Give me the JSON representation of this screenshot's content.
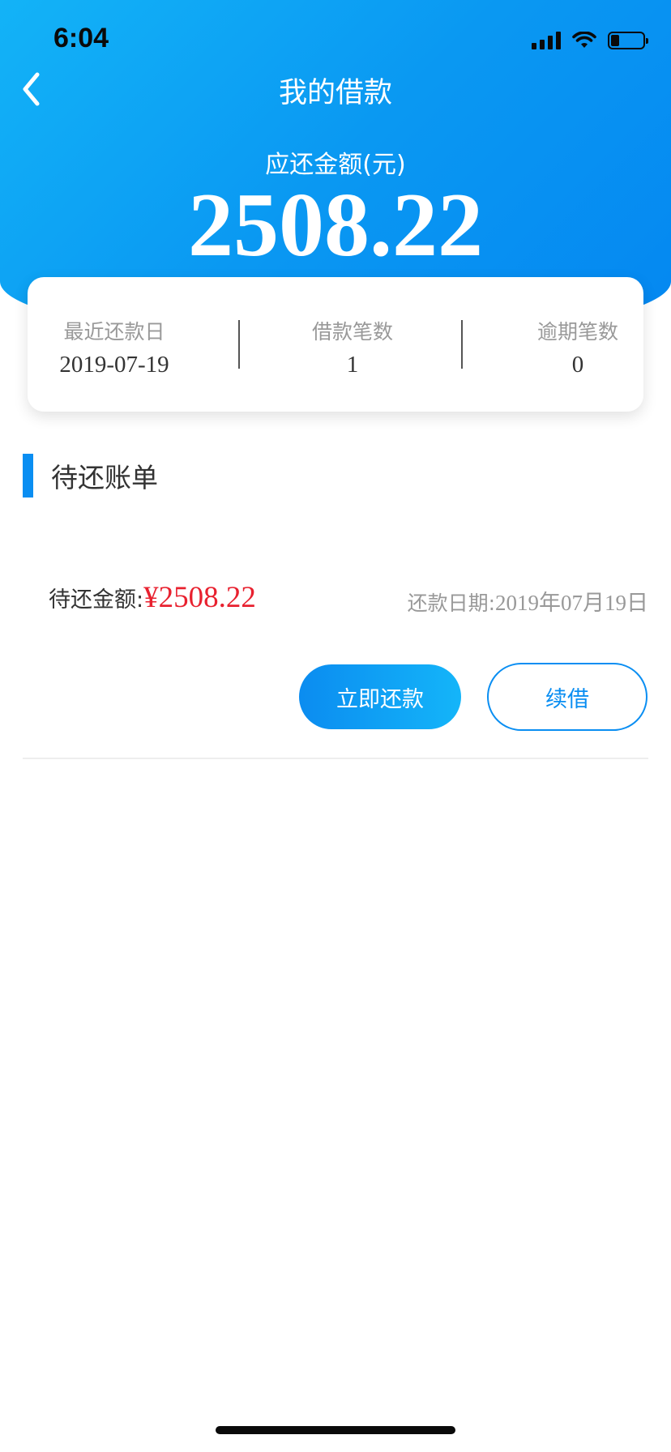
{
  "status_bar": {
    "time": "6:04",
    "battery_level": 0.25
  },
  "header": {
    "title": "我的借款",
    "due_label": "应还金额(元)",
    "due_amount": "2508.22"
  },
  "summary": {
    "stats": [
      {
        "label": "最近还款日",
        "value": "2019-07-19"
      },
      {
        "label": "借款笔数",
        "value": "1"
      },
      {
        "label": "逾期笔数",
        "value": "0"
      }
    ]
  },
  "section": {
    "title": "待还账单"
  },
  "bill": {
    "amount_label": "待还金额:",
    "amount_value": "¥2508.22",
    "date_label": "还款日期:",
    "date_value": "2019年07月19日",
    "repay_button": "立即还款",
    "renew_button": "续借"
  },
  "colors": {
    "accent": "#0a8ef2",
    "amount_red": "#e8212f"
  },
  "icons": {
    "back": "chevron-left-icon",
    "signal": "cellular-signal-icon",
    "wifi": "wifi-icon",
    "battery": "battery-icon"
  }
}
